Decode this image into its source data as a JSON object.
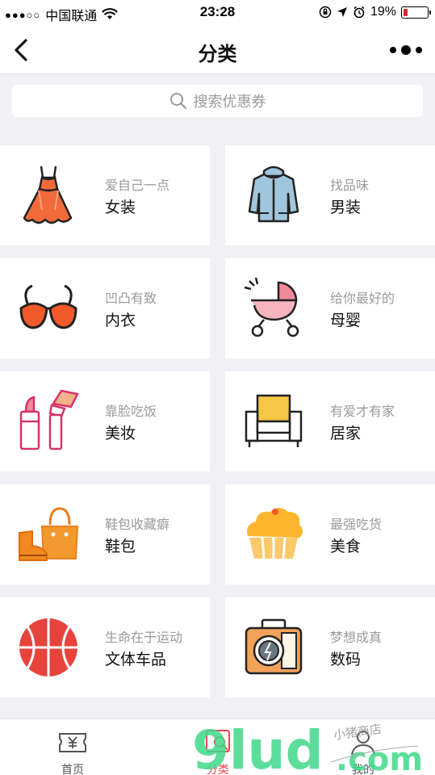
{
  "status_bar": {
    "signal_dots": "●●●○○",
    "carrier": "中国联通",
    "time": "23:28",
    "battery_percent": "19%",
    "battery_level": 0.19
  },
  "navbar": {
    "title": "分类",
    "back_icon": "chevron-left-icon",
    "more_icon": "more-dots-icon"
  },
  "search": {
    "placeholder": "搜索优惠券",
    "icon": "search-icon"
  },
  "categories": [
    {
      "sub": "爱自己一点",
      "name": "女装",
      "icon": "dress-icon"
    },
    {
      "sub": "找品味",
      "name": "男装",
      "icon": "jacket-icon"
    },
    {
      "sub": "凹凸有致",
      "name": "内衣",
      "icon": "bra-icon"
    },
    {
      "sub": "给你最好的",
      "name": "母婴",
      "icon": "stroller-icon"
    },
    {
      "sub": "靠脸吃饭",
      "name": "美妆",
      "icon": "makeup-icon"
    },
    {
      "sub": "有爱才有家",
      "name": "居家",
      "icon": "sofa-icon"
    },
    {
      "sub": "鞋包收藏癖",
      "name": "鞋包",
      "icon": "shoe-bag-icon"
    },
    {
      "sub": "最强吃货",
      "name": "美食",
      "icon": "cake-icon"
    },
    {
      "sub": "生命在于运动",
      "name": "文体车品",
      "icon": "basketball-icon"
    },
    {
      "sub": "梦想成真",
      "name": "数码",
      "icon": "camera-icon"
    }
  ],
  "tabbar": {
    "tabs": [
      {
        "label": "首页",
        "icon": "coupon-yen-icon"
      },
      {
        "label": "分类",
        "icon": "category-search-icon",
        "active": true
      },
      {
        "label": "我的",
        "icon": "profile-icon"
      }
    ]
  },
  "watermark": {
    "brand": "9lud.com",
    "handwritten": "小猪商店"
  },
  "colors": {
    "accent": "#f0444a",
    "background": "#f1f0f5",
    "watermark_green": "#3fd88a"
  }
}
